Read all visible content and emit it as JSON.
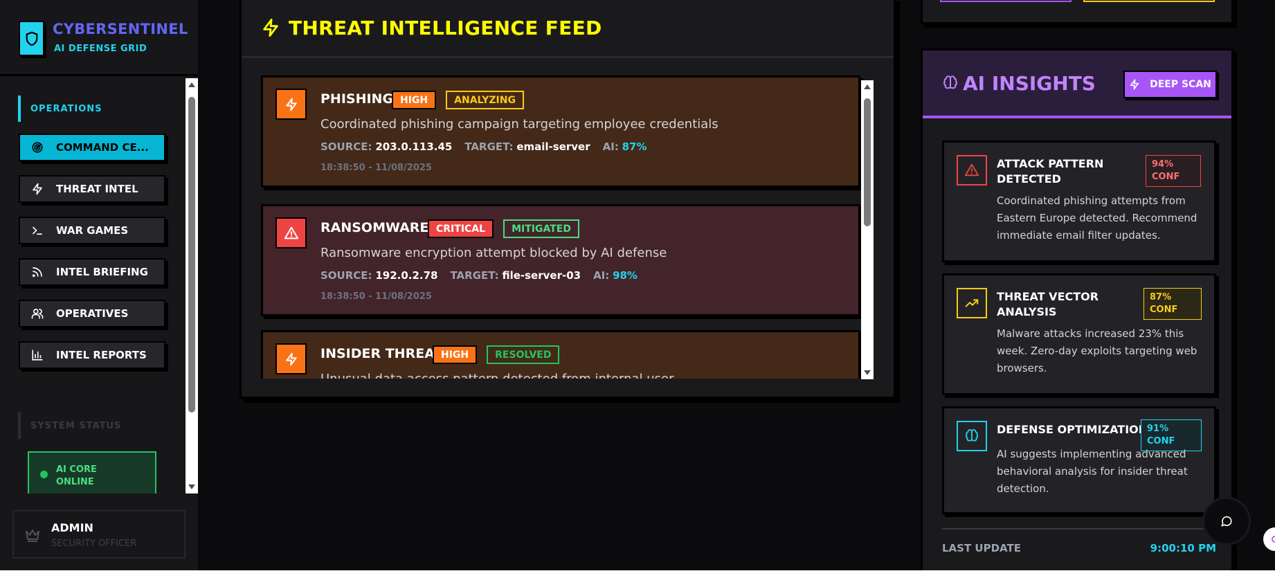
{
  "brand": {
    "title": "CYBERSENTINEL",
    "subtitle": "AI DEFENSE GRID"
  },
  "sidebar": {
    "section_operations": "OPERATIONS",
    "items": [
      {
        "label": "COMMAND CE...",
        "icon": "radar-icon",
        "active": true
      },
      {
        "label": "THREAT INTEL",
        "icon": "zap-icon"
      },
      {
        "label": "WAR GAMES",
        "icon": "terminal-icon"
      },
      {
        "label": "INTEL BRIEFING",
        "icon": "rss-icon"
      },
      {
        "label": "OPERATIVES",
        "icon": "users-icon"
      },
      {
        "label": "INTEL REPORTS",
        "icon": "bar-chart-icon"
      }
    ],
    "section_system": "SYSTEM STATUS",
    "core_status": "AI CORE ONLINE"
  },
  "user": {
    "name": "ADMIN",
    "role": "SECURITY OFFICER"
  },
  "feed": {
    "title": "THREAT INTELLIGENCE FEED",
    "source_label": "SOURCE:",
    "target_label": "TARGET:",
    "ai_label": "AI:",
    "cards": [
      {
        "type": "PHISHING",
        "severity": "HIGH",
        "status": "ANALYZING",
        "description": "Coordinated phishing campaign targeting employee credentials",
        "source": "203.0.113.45",
        "target": "email-server",
        "ai": "87%",
        "time": "18:38:50 - 11/08/2025"
      },
      {
        "type": "RANSOMWARE",
        "severity": "CRITICAL",
        "status": "MITIGATED",
        "description": "Ransomware encryption attempt blocked by AI defense",
        "source": "192.0.2.78",
        "target": "file-server-03",
        "ai": "98%",
        "time": "18:38:50 - 11/08/2025"
      },
      {
        "type": "INSIDER THREAT",
        "severity": "HIGH",
        "status": "RESOLVED",
        "description": "Unusual data access pattern detected from internal user"
      }
    ]
  },
  "ai_insights": {
    "title": "AI INSIGHTS",
    "deep_scan": "DEEP SCAN",
    "items": [
      {
        "title": "ATTACK PATTERN DETECTED",
        "conf": "94% CONF",
        "description": "Coordinated phishing attempts from Eastern Europe detected. Recommend immediate email filter updates.",
        "icon": "alert-triangle-icon",
        "color": "#ef4444"
      },
      {
        "title": "THREAT VECTOR ANALYSIS",
        "conf": "87% CONF",
        "description": "Malware attacks increased 23% this week. Zero-day exploits targeting web browsers.",
        "icon": "trending-up-icon",
        "color": "#facc15"
      },
      {
        "title": "DEFENSE OPTIMIZATION",
        "conf": "91% CONF",
        "description": "AI suggests implementing advanced behavioral analysis for insider threat detection.",
        "icon": "brain-icon",
        "color": "#22d3ee"
      }
    ],
    "last_update_label": "LAST UPDATE",
    "last_update_value": "9:00:10 PM"
  }
}
